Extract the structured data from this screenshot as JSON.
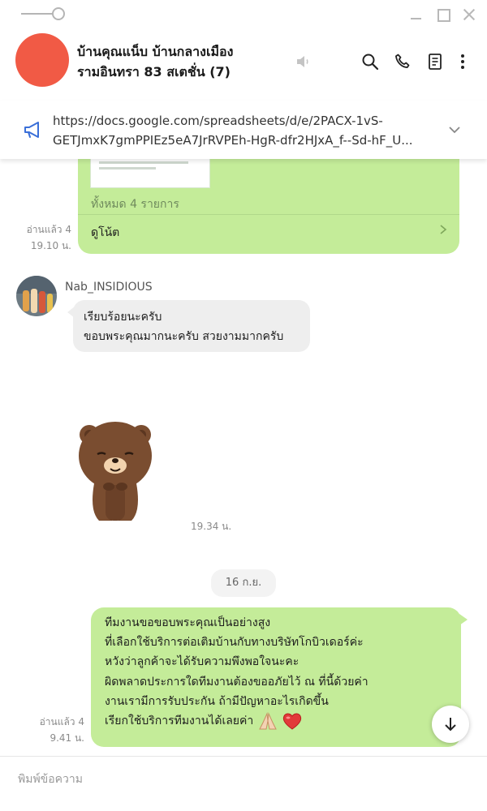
{
  "window": {
    "controls": [
      "pin-icon",
      "minimize-icon",
      "maximize-icon",
      "close-icon"
    ]
  },
  "header": {
    "title_line1": "บ้านคุณแน็บ บ้านกลางเมือง",
    "title_line2": "รามอินทรา 83 สเตชั่น (7)",
    "avatar_color": "#f15a45",
    "icons": [
      "mute-icon",
      "search-icon",
      "call-icon",
      "notes-icon",
      "more-icon"
    ]
  },
  "announcement": {
    "line1": "https://docs.google.com/spreadsheets/d/e/2PACX-1vS-",
    "line2": "GETJmxK7gmPPIEz5eA7JrRVPEh-HgR-dfr2HJxA_f--Sd-hF_U..."
  },
  "messages": {
    "note_card": {
      "count_text": "ทั้งหมด 4 รายการ",
      "link_text": "ดูโน้ต",
      "read_label": "อ่านแล้ว 4",
      "time": "19.10 น."
    },
    "incoming": {
      "sender": "Nab_INSIDIOUS",
      "line1": "เรียบร้อยนะครับ",
      "line2": "ขอบพระคุณมากนะครับ สวยงามมากครับ"
    },
    "sticker": {
      "time": "19.34 น."
    },
    "date_separator": "16 ก.ย.",
    "outgoing": {
      "lines": [
        "ทีมงานขอขอบพระคุณเป็นอย่างสูง",
        "ที่เลือกใช้บริการต่อเติมบ้านกับทางบริษัทโกบิวเดอร์ค่ะ",
        "หวังว่าลูกค้าจะได้รับความพึงพอใจนะคะ",
        "ผิดพลาดประการใดทีมงานต้องขออภัยไว้ ณ ที่นี้ด้วยค่า",
        "งานเรามีการรับประกัน ถ้ามีปัญหาอะไรเกิดขึ้น",
        "เรียกใช้บริการทีมงานได้เลยค่า"
      ],
      "read_label": "อ่านแล้ว 4",
      "time": "9.41 น."
    }
  },
  "composer": {
    "placeholder": "พิมพ์ข้อความ"
  },
  "colors": {
    "bubble_out": "#c4ec99",
    "bubble_in": "#eeeeee",
    "accent_blue": "#3a6fd8"
  }
}
